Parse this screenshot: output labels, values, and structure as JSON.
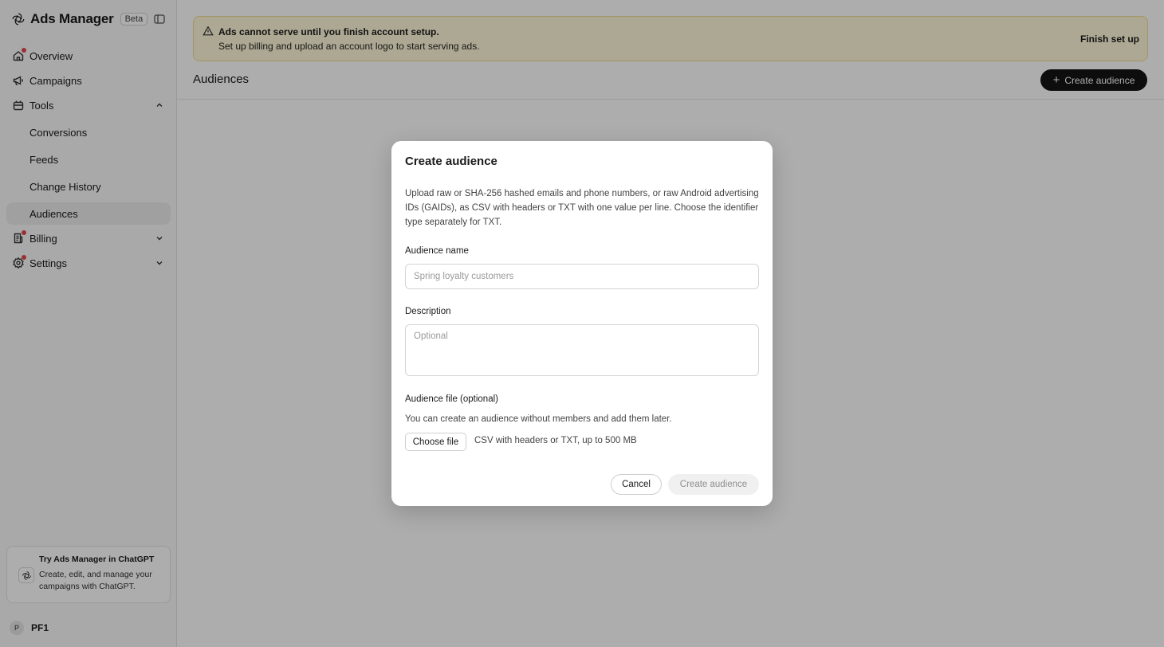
{
  "sidebar": {
    "brand": {
      "title": "Ads Manager",
      "badge": "Beta"
    },
    "nav": [
      {
        "label": "Overview",
        "icon": "home-icon",
        "dot": true
      },
      {
        "label": "Campaigns",
        "icon": "megaphone-icon",
        "dot": false
      },
      {
        "label": "Tools",
        "icon": "toolbox-icon",
        "dot": false,
        "expanded": true
      },
      {
        "label": "Billing",
        "icon": "receipt-icon",
        "dot": true,
        "expanded": false
      },
      {
        "label": "Settings",
        "icon": "gear-icon",
        "dot": true,
        "expanded": false
      }
    ],
    "tools_items": [
      "Conversions",
      "Feeds",
      "Change History",
      "Audiences"
    ],
    "active_item": "Audiences",
    "promo": {
      "title": "Try Ads Manager in ChatGPT",
      "text": "Create, edit, and manage your campaigns with ChatGPT."
    },
    "account": {
      "initial": "P",
      "name": "PF1"
    }
  },
  "banner": {
    "title": "Ads cannot serve until you finish account setup.",
    "text": "Set up billing and upload an account logo to start serving ads.",
    "action": "Finish set up",
    "color": "#fff8d9"
  },
  "header": {
    "title": "Audiences",
    "create_button": "Create audience"
  },
  "background_hint": "s",
  "modal": {
    "title": "Create audience",
    "description": "Upload raw or SHA-256 hashed emails and phone numbers, or raw Android advertising IDs (GAIDs), as CSV with headers or TXT with one value per line. Choose the identifier type separately for TXT.",
    "name_label": "Audience name",
    "name_placeholder": "Spring loyalty customers",
    "description_label": "Description",
    "description_placeholder": "Optional",
    "file_label": "Audience file (optional)",
    "file_hint": "You can create an audience without members and add them later.",
    "file_button": "Choose file",
    "file_meta": "CSV with headers or TXT, up to 500 MB",
    "cancel": "Cancel",
    "submit": "Create audience"
  },
  "colors": {
    "accent": "#141414",
    "notification_dot": "#e5484d",
    "banner_border": "#f1dc8d"
  }
}
